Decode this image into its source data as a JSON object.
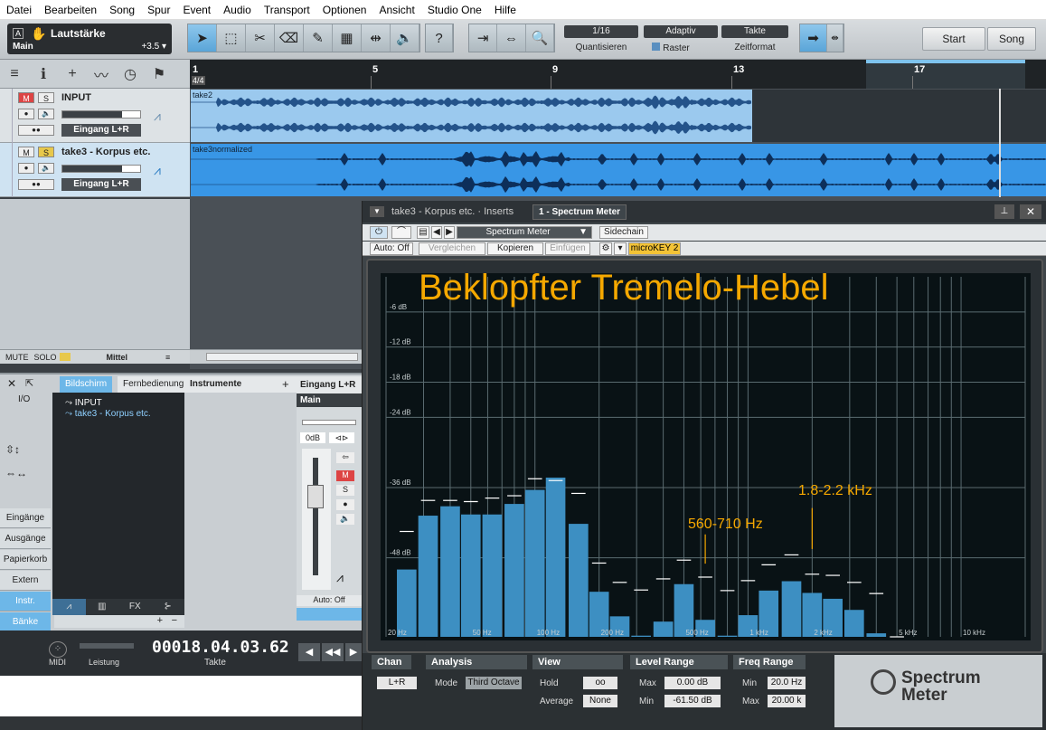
{
  "menu": [
    "Datei",
    "Bearbeiten",
    "Song",
    "Spur",
    "Event",
    "Audio",
    "Transport",
    "Optionen",
    "Ansicht",
    "Studio One",
    "Hilfe"
  ],
  "toolbar": {
    "volume_label": "Lautstärke",
    "main_label": "Main",
    "volume_value": "+3.5",
    "a_label": "A",
    "help_label": "?",
    "quantize_value": "1/16",
    "quantize_label": "Quantisieren",
    "adaptive_value": "Adaptiv",
    "raster_label": "Raster",
    "timeformat_value": "Takte",
    "timeformat_label": "Zeitformat",
    "start_label": "Start",
    "song_label": "Song"
  },
  "tracks": [
    {
      "name": "INPUT",
      "mute": "M",
      "solo": "S",
      "io": "Eingang L+R",
      "clip": "take2"
    },
    {
      "name": "take3 - Korpus etc.",
      "mute": "M",
      "solo": "S",
      "io": "Eingang L+R",
      "clip": "take3normalized"
    }
  ],
  "ruler": {
    "bars": [
      "1",
      "5",
      "9",
      "13",
      "17"
    ],
    "signature": "4/4"
  },
  "mutebar": {
    "mute": "MUTE",
    "solo": "SOLO",
    "mid": "Mittel"
  },
  "console": {
    "tabs": [
      "Bildschirm",
      "Fernbedienung"
    ],
    "instruments": "Instrumente",
    "input_label": "Eingang L+R",
    "main_label": "Main",
    "io_label": "I/O",
    "side_items": [
      "Eingänge",
      "Ausgänge",
      "Papierkorb",
      "Extern",
      "Instr.",
      "Bänke"
    ],
    "list": [
      "INPUT",
      "take3 - Korpus etc."
    ],
    "channel_db": "0dB",
    "auto": "Auto: Off",
    "bottom_tab_fx": "FX"
  },
  "transport": {
    "time": "00018.04.03.62",
    "time_label": "Takte",
    "midi": "MIDI",
    "perf": "Leistung"
  },
  "plugin": {
    "title": "take3 - Korpus etc. · Inserts",
    "tab": "1 - Spectrum Meter",
    "preset": "Spectrum Meter",
    "sidechain": "Sidechain",
    "auto": "Auto: Off",
    "compare": "Vergleichen",
    "copy": "Kopieren",
    "paste": "Einfügen",
    "microkey": "microKEY 2",
    "annotation_title": "Beklopfter Tremelo-Hebel",
    "annotation_a": "560-710 Hz",
    "annotation_b": "1.8-2.2 kHz",
    "controls": {
      "chan": "Chan",
      "chan_value": "L+R",
      "analysis": "Analysis",
      "mode_label": "Mode",
      "mode_value": "Third Octave",
      "view": "View",
      "hold_label": "Hold",
      "hold_value": "oo",
      "average_label": "Average",
      "average_value": "None",
      "level_range": "Level Range",
      "max_label": "Max",
      "max_value": "0.00 dB",
      "min_label": "Min",
      "min_value": "-61.50 dB",
      "freq_range": "Freq Range",
      "fmin_label": "Min",
      "fmin_value": "20.0 Hz",
      "fmax_label": "Max",
      "fmax_value": "20.00 k",
      "brand_1": "Spectrum",
      "brand_2": "Meter"
    }
  },
  "chart_data": {
    "type": "bar",
    "title": "",
    "xlabel": "",
    "ylabel": "",
    "x_scale": "log",
    "xlim": [
      20,
      20000
    ],
    "ylim": [
      -61.5,
      0
    ],
    "x_ticks": [
      {
        "v": 20,
        "label": "20 Hz"
      },
      {
        "v": 50,
        "label": "50 Hz"
      },
      {
        "v": 100,
        "label": "100 Hz"
      },
      {
        "v": 200,
        "label": "200 Hz"
      },
      {
        "v": 500,
        "label": "500 Hz"
      },
      {
        "v": 1000,
        "label": "1 kHz"
      },
      {
        "v": 2000,
        "label": "2 kHz"
      },
      {
        "v": 5000,
        "label": "5 kHz"
      },
      {
        "v": 10000,
        "label": "10 kHz"
      }
    ],
    "y_ticks": [
      {
        "v": -6,
        "label": "-6 dB"
      },
      {
        "v": -12,
        "label": "-12 dB"
      },
      {
        "v": -18,
        "label": "-18 dB"
      },
      {
        "v": -24,
        "label": "-24 dB"
      },
      {
        "v": -36,
        "label": "-36 dB"
      },
      {
        "v": -48,
        "label": "-48 dB"
      }
    ],
    "grid": true,
    "bar_color": "#3d8fc2",
    "peak_color": "#ffffff",
    "series": [
      {
        "x": [
          25,
          31.5,
          40,
          50,
          63,
          80,
          100,
          125,
          160,
          200,
          250,
          315,
          400,
          500,
          630,
          800,
          1000,
          1250,
          1600,
          2000,
          2500,
          3150,
          4000,
          5000
        ],
        "values": [
          -50,
          -40.8,
          -39.2,
          -40.6,
          -40.6,
          -38.8,
          -36.4,
          -34.3,
          -42.2,
          -53.8,
          -58,
          -61.3,
          -58.9,
          -52.5,
          -58.6,
          -61.3,
          -57.8,
          -53.6,
          -52,
          -54,
          -55,
          -56.9,
          -60.9,
          -61.5
        ],
        "peaks": [
          -43.5,
          -38.2,
          -38.2,
          -38.4,
          -37.8,
          -37.4,
          -34.5,
          -34.8,
          -37,
          -48.9,
          -52.2,
          -53.5,
          -51.6,
          -48.4,
          -51.3,
          -53.6,
          -51.9,
          -49.2,
          -47.5,
          -50.8,
          -51,
          -52.2,
          -54.1,
          -61.5
        ]
      }
    ]
  }
}
